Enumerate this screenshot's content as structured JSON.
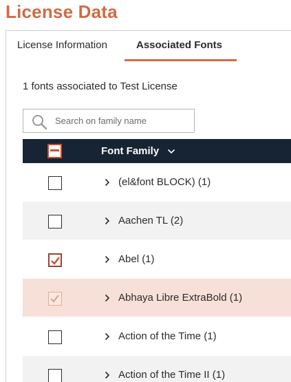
{
  "page": {
    "title": "License Data"
  },
  "tabs": [
    {
      "label": "License Information",
      "active": false
    },
    {
      "label": "Associated Fonts",
      "active": true
    }
  ],
  "summary": {
    "count_text": "1 fonts associated to Test License"
  },
  "search": {
    "placeholder": "Search on family name",
    "value": ""
  },
  "table": {
    "header": {
      "column_label": "Font Family",
      "select_all_state": "indeterminate"
    },
    "rows": [
      {
        "label": "(el&font BLOCK) (1)",
        "checked": false
      },
      {
        "label": "Aachen TL (2)",
        "checked": false
      },
      {
        "label": "Abel (1)",
        "checked": true
      },
      {
        "label": "Abhaya Libre ExtraBold (1)",
        "checked": true
      },
      {
        "label": "Action of the Time (1)",
        "checked": false
      },
      {
        "label": "Action of the Time II (1)",
        "checked": false
      }
    ]
  },
  "colors": {
    "accent": "#d06a45",
    "header_bg": "#172433",
    "selected_row": "#f7e0d8",
    "alt_row": "#f2f2f2"
  },
  "icons": {
    "search": "search-icon",
    "sort": "chevron-down-icon",
    "expand": "chevron-right-icon",
    "check": "check-icon"
  }
}
